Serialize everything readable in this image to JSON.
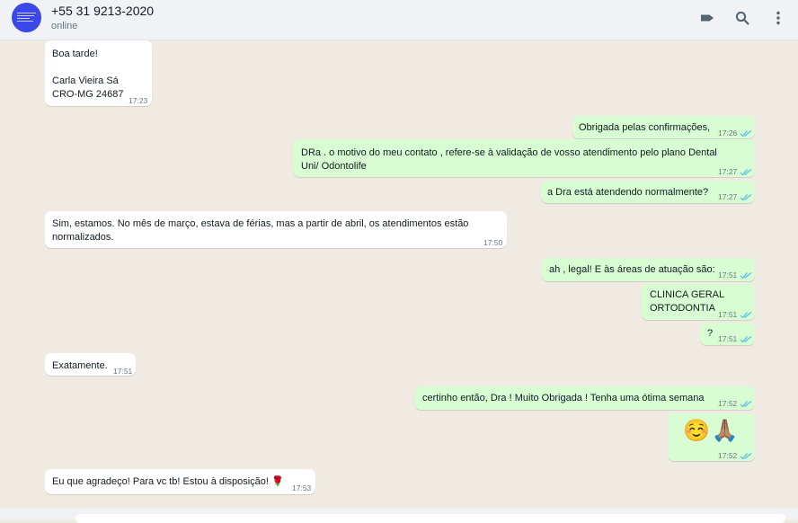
{
  "header": {
    "contact_name": "+55 31 9213-2020",
    "status": "online",
    "icons": [
      "label-icon",
      "search-icon",
      "menu-icon"
    ]
  },
  "colors": {
    "incoming_bubble": "#ffffff",
    "outgoing_bubble": "#d9fdd3",
    "chat_background": "#efeae2",
    "read_ticks": "#53bdeb"
  },
  "messages": [
    {
      "direction": "in",
      "lines": [
        "Boa tarde!",
        "",
        "Carla Vieira Sá",
        "CRO-MG 24687"
      ],
      "time": "17:23"
    },
    {
      "direction": "out",
      "lines": [
        "Obrigada pelas confirmações,"
      ],
      "time": "17:26"
    },
    {
      "direction": "out",
      "lines": [
        "DRa . o motivo do meu contato , refere-se à validação de vosso atendimento pelo plano Dental",
        "Uni/ Odontolife"
      ],
      "time": "17:27"
    },
    {
      "direction": "out",
      "lines": [
        "a Dra está atendendo normalmente?"
      ],
      "time": "17:27"
    },
    {
      "direction": "in",
      "lines": [
        "Sim, estamos. No mês de março, estava de férias, mas a partir de abril, os atendimentos estão",
        "normalizados."
      ],
      "time": "17:50"
    },
    {
      "direction": "out",
      "lines": [
        "ah , legal! E às áreas de atuação são:"
      ],
      "time": "17:51"
    },
    {
      "direction": "out",
      "lines": [
        "CLINICA GERAL",
        "ORTODONTIA"
      ],
      "time": "17:51"
    },
    {
      "direction": "out",
      "lines": [
        "?"
      ],
      "time": "17:51"
    },
    {
      "direction": "in",
      "lines": [
        "Exatamente."
      ],
      "time": "17:51"
    },
    {
      "direction": "out",
      "lines": [
        "certinho então, Dra ! Muito Obrigada ! Tenha uma ótima semana"
      ],
      "time": "17:52"
    },
    {
      "direction": "out",
      "lines": [
        "☺️🙏🏽"
      ],
      "time": "17:52"
    },
    {
      "direction": "in",
      "lines": [
        "Eu que agradeço! Para vc tb! Estou à disposição! 🌹"
      ],
      "time": "17:53"
    }
  ]
}
